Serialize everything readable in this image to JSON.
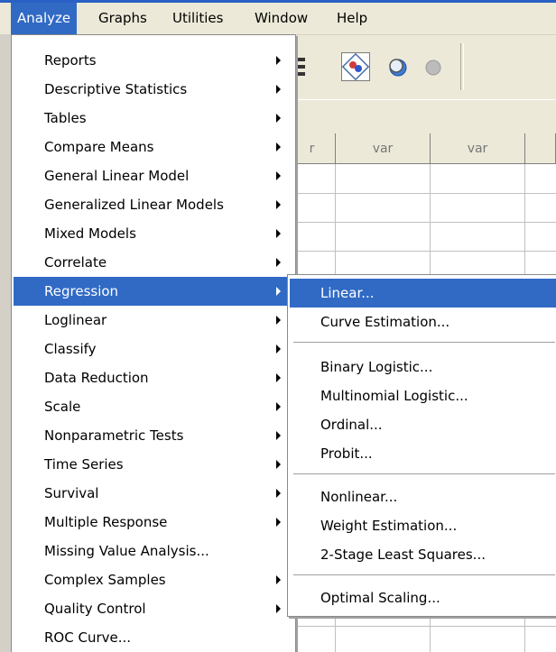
{
  "menubar": {
    "items": [
      {
        "label": "Analyze",
        "active": true
      },
      {
        "label": "Graphs"
      },
      {
        "label": "Utilities"
      },
      {
        "label": "Window"
      },
      {
        "label": "Help"
      }
    ]
  },
  "grid": {
    "headers": [
      "r",
      "var",
      "var",
      ""
    ]
  },
  "analyze_menu": {
    "items": [
      {
        "label": "Reports",
        "submenu": true
      },
      {
        "label": "Descriptive Statistics",
        "submenu": true
      },
      {
        "label": "Tables",
        "submenu": true
      },
      {
        "label": "Compare Means",
        "submenu": true
      },
      {
        "label": "General Linear Model",
        "submenu": true
      },
      {
        "label": "Generalized Linear Models",
        "submenu": true
      },
      {
        "label": "Mixed Models",
        "submenu": true
      },
      {
        "label": "Correlate",
        "submenu": true
      },
      {
        "label": "Regression",
        "submenu": true,
        "highlighted": true
      },
      {
        "label": "Loglinear",
        "submenu": true
      },
      {
        "label": "Classify",
        "submenu": true
      },
      {
        "label": "Data Reduction",
        "submenu": true
      },
      {
        "label": "Scale",
        "submenu": true
      },
      {
        "label": "Nonparametric Tests",
        "submenu": true
      },
      {
        "label": "Time Series",
        "submenu": true
      },
      {
        "label": "Survival",
        "submenu": true
      },
      {
        "label": "Multiple Response",
        "submenu": true
      },
      {
        "label": "Missing Value Analysis...",
        "submenu": false
      },
      {
        "label": "Complex Samples",
        "submenu": true
      },
      {
        "label": "Quality Control",
        "submenu": true
      },
      {
        "label": "ROC Curve...",
        "submenu": false
      }
    ]
  },
  "regression_submenu": {
    "items": [
      {
        "label": "Linear...",
        "highlighted": true
      },
      {
        "label": "Curve Estimation..."
      },
      {
        "label": "Binary Logistic..."
      },
      {
        "label": "Multinomial Logistic..."
      },
      {
        "label": "Ordinal..."
      },
      {
        "label": "Probit..."
      },
      {
        "label": "Nonlinear..."
      },
      {
        "label": "Weight Estimation..."
      },
      {
        "label": "2-Stage Least Squares..."
      },
      {
        "label": "Optimal Scaling..."
      }
    ]
  },
  "colors": {
    "highlight": "#316ac5",
    "menubar_bg": "#ece9d8",
    "menu_bg": "#ffffff"
  }
}
